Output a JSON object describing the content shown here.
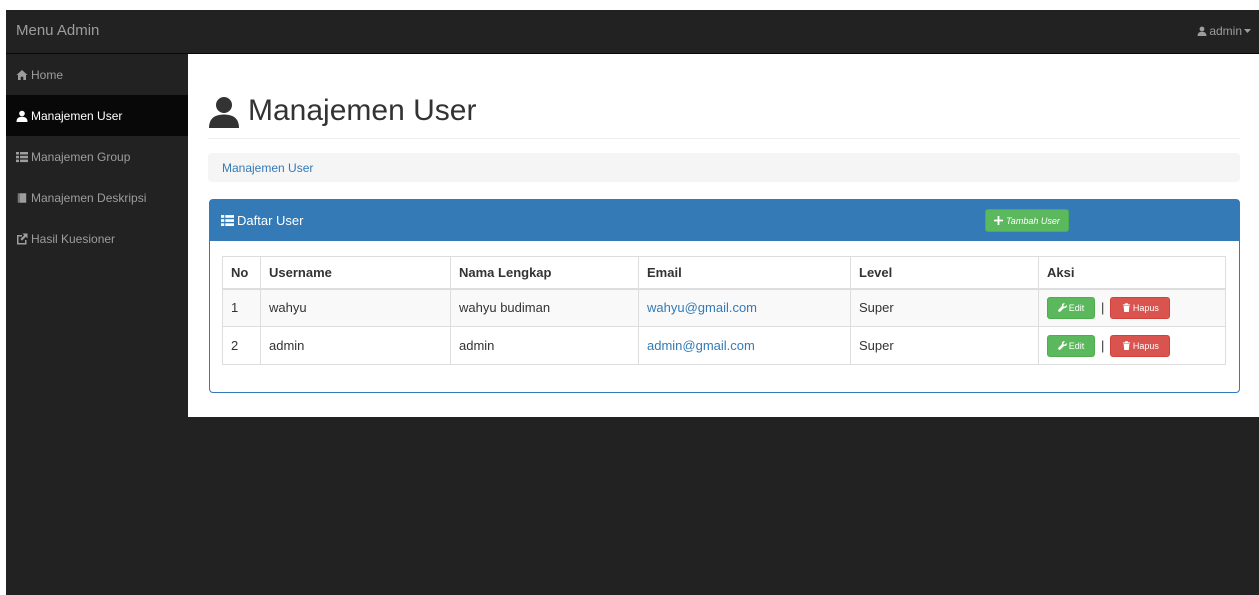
{
  "topbar": {
    "brand": "Menu Admin",
    "user": "admin"
  },
  "sidebar": {
    "items": [
      {
        "label": "Home",
        "icon": "home-icon",
        "active": false
      },
      {
        "label": "Manajemen User",
        "icon": "user-icon",
        "active": true
      },
      {
        "label": "Manajemen Group",
        "icon": "list-icon",
        "active": false
      },
      {
        "label": "Manajemen Deskripsi",
        "icon": "book-icon",
        "active": false
      },
      {
        "label": "Hasil Kuesioner",
        "icon": "share-icon",
        "active": false
      }
    ]
  },
  "main": {
    "title": "Manajemen User",
    "breadcrumb": "Manajemen User",
    "panel": {
      "title": "Daftar User",
      "add_button": "Tambah User",
      "columns": [
        "No",
        "Username",
        "Nama Lengkap",
        "Email",
        "Level",
        "Aksi"
      ],
      "rows": [
        {
          "no": "1",
          "username": "wahyu",
          "nama": "wahyu budiman",
          "email": "wahyu@gmail.com",
          "level": "Super"
        },
        {
          "no": "2",
          "username": "admin",
          "nama": "admin",
          "email": "admin@gmail.com",
          "level": "Super"
        }
      ],
      "edit_label": "Edit",
      "delete_label": "Hapus",
      "separator": "|"
    }
  },
  "colors": {
    "navbar": "#222222",
    "primary": "#337ab7",
    "success": "#5cb85c",
    "danger": "#d9534f"
  }
}
